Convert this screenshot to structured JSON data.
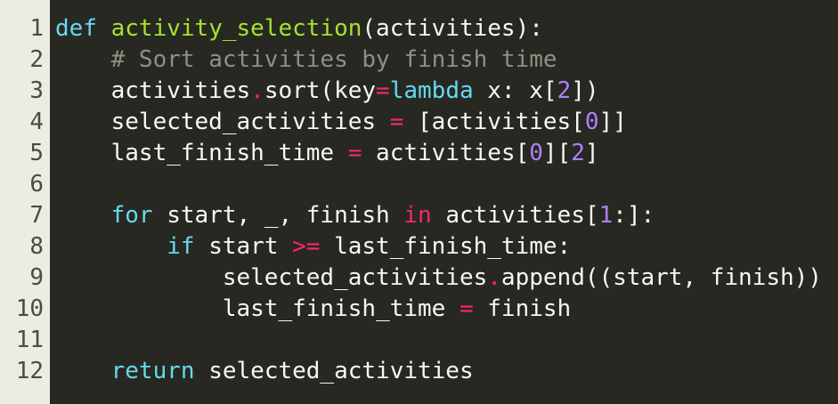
{
  "colors": {
    "background": "#272822",
    "gutter": "#ECECE0",
    "line_number": "#4A4A4A",
    "text": "#F8F8F2",
    "keyword": "#66D9EF",
    "function_name": "#A6E22E",
    "operator": "#F92672",
    "number": "#AE81FF",
    "comment": "#8F8F83"
  },
  "line_numbers": [
    "1",
    "2",
    "3",
    "4",
    "5",
    "6",
    "7",
    "8",
    "9",
    "10",
    "11",
    "12"
  ],
  "lines": [
    [
      {
        "t": "def",
        "c": "kw"
      },
      {
        "t": " ",
        "c": "txt"
      },
      {
        "t": "activity_selection",
        "c": "fn"
      },
      {
        "t": "(activities):",
        "c": "txt"
      }
    ],
    [
      {
        "t": "    ",
        "c": "txt"
      },
      {
        "t": "# Sort activities by finish time",
        "c": "cm"
      }
    ],
    [
      {
        "t": "    activities",
        "c": "txt"
      },
      {
        "t": ".",
        "c": "op"
      },
      {
        "t": "sort(key",
        "c": "txt"
      },
      {
        "t": "=",
        "c": "op"
      },
      {
        "t": "lambda",
        "c": "kw"
      },
      {
        "t": " x: x[",
        "c": "txt"
      },
      {
        "t": "2",
        "c": "num"
      },
      {
        "t": "])",
        "c": "txt"
      }
    ],
    [
      {
        "t": "    selected_activities ",
        "c": "txt"
      },
      {
        "t": "=",
        "c": "op"
      },
      {
        "t": " [activities[",
        "c": "txt"
      },
      {
        "t": "0",
        "c": "num"
      },
      {
        "t": "]]",
        "c": "txt"
      }
    ],
    [
      {
        "t": "    last_finish_time ",
        "c": "txt"
      },
      {
        "t": "=",
        "c": "op"
      },
      {
        "t": " activities[",
        "c": "txt"
      },
      {
        "t": "0",
        "c": "num"
      },
      {
        "t": "][",
        "c": "txt"
      },
      {
        "t": "2",
        "c": "num"
      },
      {
        "t": "]",
        "c": "txt"
      }
    ],
    [],
    [
      {
        "t": "    ",
        "c": "txt"
      },
      {
        "t": "for",
        "c": "kw"
      },
      {
        "t": " start, _, finish ",
        "c": "txt"
      },
      {
        "t": "in",
        "c": "op"
      },
      {
        "t": " activities[",
        "c": "txt"
      },
      {
        "t": "1",
        "c": "num"
      },
      {
        "t": ":]:",
        "c": "txt"
      }
    ],
    [
      {
        "t": "        ",
        "c": "txt"
      },
      {
        "t": "if",
        "c": "kw"
      },
      {
        "t": " start ",
        "c": "txt"
      },
      {
        "t": ">=",
        "c": "op"
      },
      {
        "t": " last_finish_time:",
        "c": "txt"
      }
    ],
    [
      {
        "t": "            selected_activities",
        "c": "txt"
      },
      {
        "t": ".",
        "c": "op"
      },
      {
        "t": "append((start, finish))",
        "c": "txt"
      }
    ],
    [
      {
        "t": "            last_finish_time ",
        "c": "txt"
      },
      {
        "t": "=",
        "c": "op"
      },
      {
        "t": " finish",
        "c": "txt"
      }
    ],
    [],
    [
      {
        "t": "    ",
        "c": "txt"
      },
      {
        "t": "return",
        "c": "kw"
      },
      {
        "t": " selected_activities",
        "c": "txt"
      }
    ]
  ]
}
